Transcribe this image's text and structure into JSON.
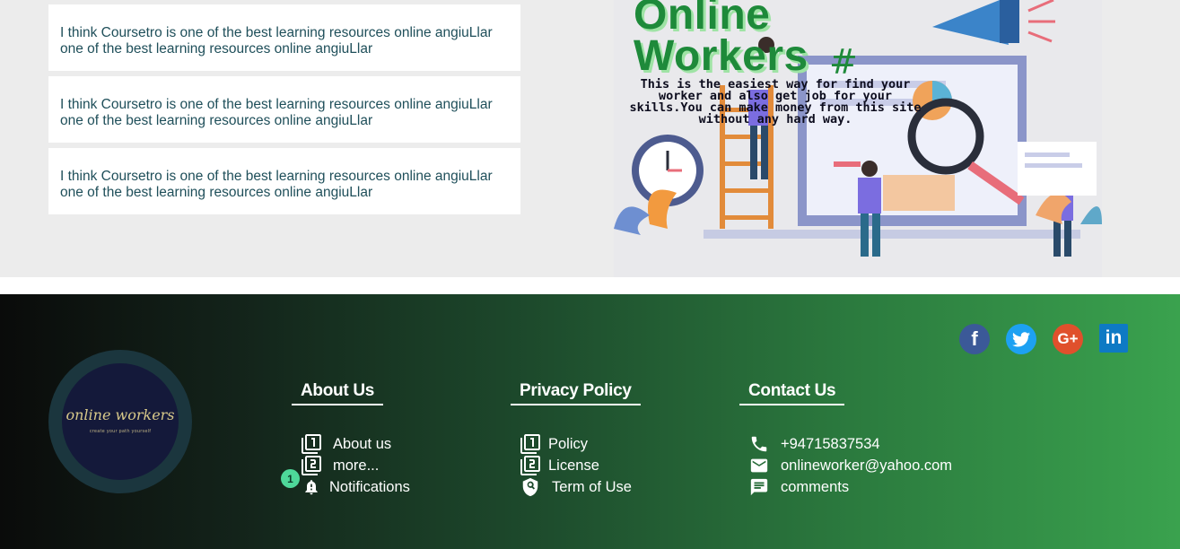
{
  "comments": [
    {
      "text": "I think Coursetro is one of the best learning resources online angiuLlar one of the best learning resources online angiuLlar"
    },
    {
      "text": "I think Coursetro is one of the best learning resources online angiuLlar one of the best learning resources online angiuLlar"
    },
    {
      "text": "I think Coursetro is one of the best learning resources online angiuLlar one of the best learning resources online angiuLlar"
    }
  ],
  "hero": {
    "title_line1": "Online",
    "title_line2": "Workers",
    "tagline": "This is the easiest way for find your worker and also get job for your skills.You can make money from this site without any hard way."
  },
  "footer": {
    "logo": {
      "name": "online workers",
      "tagline": "create your path yourself"
    },
    "social": [
      {
        "icon": "facebook-icon",
        "glyph": "f",
        "color": "#3b5998"
      },
      {
        "icon": "twitter-icon",
        "glyph": "",
        "color": "#1da1f2"
      },
      {
        "icon": "google-plus-icon",
        "glyph": "G+",
        "color": "#e0502c"
      },
      {
        "icon": "linkedin-icon",
        "glyph": "in",
        "color": "#0e7ac4"
      }
    ],
    "about": {
      "heading": "About Us",
      "links": [
        {
          "label": "About us",
          "icon": "filter-1-icon"
        },
        {
          "label": "more...",
          "icon": "filter-2-icon"
        },
        {
          "label": "Notifications",
          "icon": "bell-icon",
          "badge": "1"
        }
      ]
    },
    "privacy": {
      "heading": "Privacy Policy",
      "links": [
        {
          "label": "Policy",
          "icon": "filter-1-icon"
        },
        {
          "label": "License",
          "icon": "filter-2-icon"
        },
        {
          "label": "Term of Use",
          "icon": "shield-search-icon"
        }
      ]
    },
    "contact": {
      "heading": "Contact Us",
      "items": [
        {
          "label": "+94715837534",
          "icon": "phone-icon"
        },
        {
          "label": "onlineworker@yahoo.com",
          "icon": "mail-icon"
        },
        {
          "label": "comments",
          "icon": "comment-icon"
        }
      ]
    }
  }
}
